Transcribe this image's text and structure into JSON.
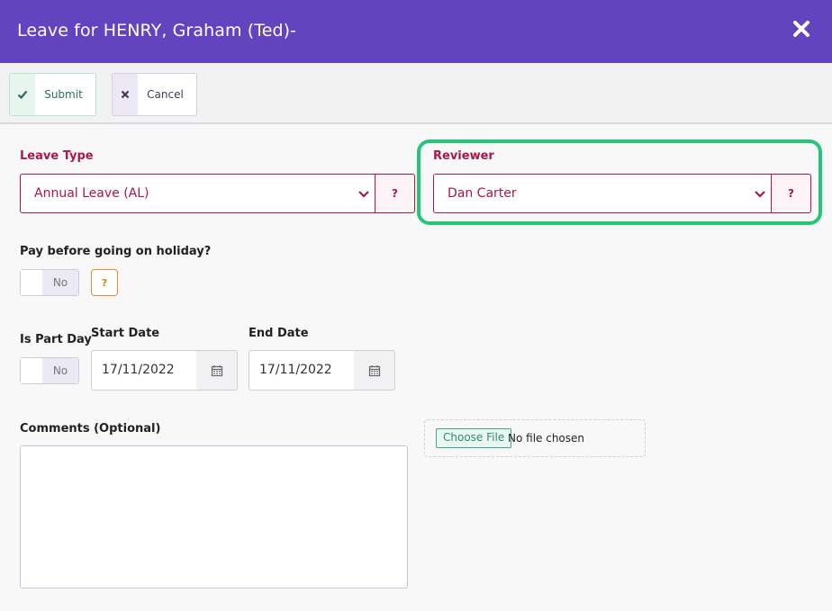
{
  "header": {
    "title": "Leave for HENRY, Graham (Ted)-",
    "close_icon": "close-icon"
  },
  "toolbar": {
    "submit_label": "Submit",
    "cancel_label": "Cancel"
  },
  "colors": {
    "header_bg": "#6444be",
    "accent_red": "#ad1744",
    "highlight_green": "#24c77a"
  },
  "leave_type": {
    "label": "Leave Type",
    "value": "Annual Leave (AL)",
    "help": "?"
  },
  "reviewer": {
    "label": "Reviewer",
    "value": "Dan Carter",
    "help": "?"
  },
  "pay_before": {
    "label": "Pay before going on holiday?",
    "toggle_value": "No",
    "help": "?"
  },
  "part_day": {
    "label": "Is Part Day",
    "toggle_value": "No"
  },
  "start_date": {
    "label": "Start Date",
    "value": "17/11/2022"
  },
  "end_date": {
    "label": "End Date",
    "value": "17/11/2022"
  },
  "comments": {
    "label": "Comments (Optional)",
    "value": ""
  },
  "file": {
    "button_label": "Choose File",
    "status": "No file chosen"
  }
}
